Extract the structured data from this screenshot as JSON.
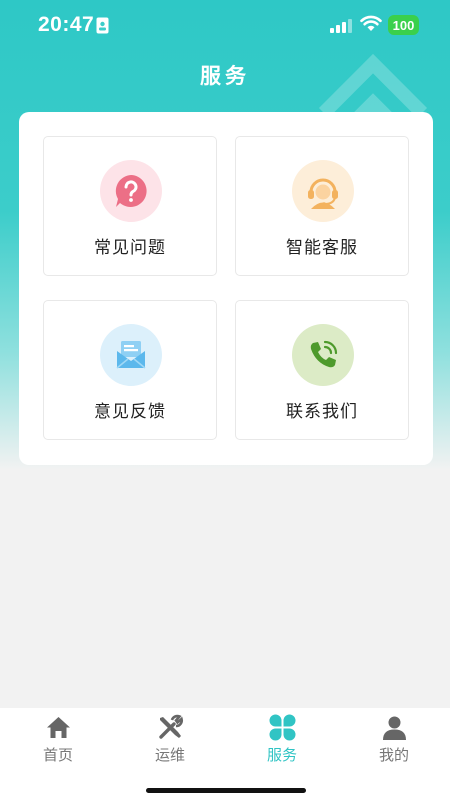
{
  "status_bar": {
    "time": "20:47",
    "battery": "100",
    "icons": [
      "id-card-icon",
      "signal-icon",
      "wifi-icon"
    ]
  },
  "header": {
    "title": "服务"
  },
  "services": [
    {
      "label": "常见问题",
      "icon": "question-bubble-icon",
      "color": "#ec6f86",
      "bg": "#fde3e8"
    },
    {
      "label": "智能客服",
      "icon": "headset-agent-icon",
      "color": "#f3b25e",
      "bg": "#fdeed9"
    },
    {
      "label": "意见反馈",
      "icon": "envelope-icon",
      "color": "#5cb8ec",
      "bg": "#dcf0fb"
    },
    {
      "label": "联系我们",
      "icon": "phone-call-icon",
      "color": "#4e9a2c",
      "bg": "#dcebc6"
    }
  ],
  "tabbar": {
    "tabs": [
      {
        "label": "首页",
        "icon": "home-icon"
      },
      {
        "label": "运维",
        "icon": "tools-icon"
      },
      {
        "label": "服务",
        "icon": "clover-icon",
        "active": true
      },
      {
        "label": "我的",
        "icon": "user-icon"
      }
    ],
    "active_color": "#30c4c4",
    "inactive_color": "#777777"
  },
  "theme": {
    "accent": "#30c4c4",
    "header_gradient_top": "#2ec8c6",
    "page_background": "#f2f2f2"
  }
}
